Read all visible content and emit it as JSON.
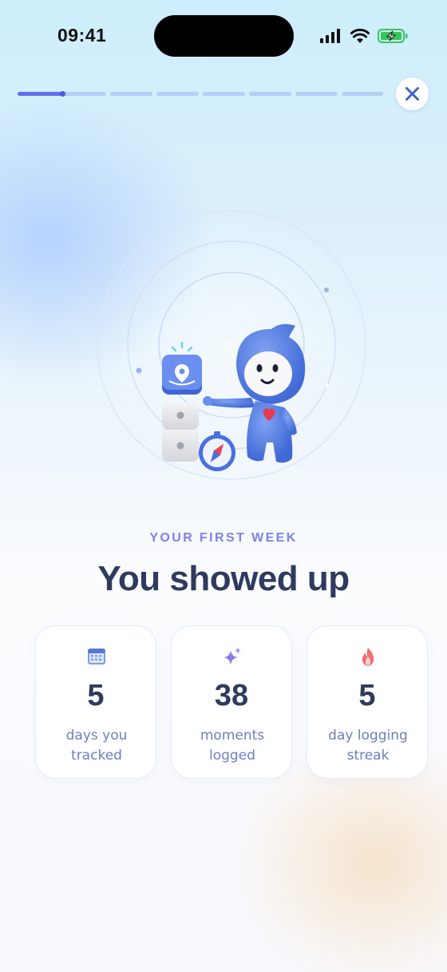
{
  "status_bar": {
    "time": "09:41"
  },
  "progress": {
    "total_steps": 8,
    "current_step": 1
  },
  "hero": {
    "kicker": "YOUR FIRST WEEK",
    "headline": "You showed up"
  },
  "stats": [
    {
      "icon": "calendar-icon",
      "value": "5",
      "label": "days you tracked",
      "icon_color": "#6b8de6"
    },
    {
      "icon": "sparkles-icon",
      "value": "38",
      "label": "moments logged",
      "icon_color": "#8a7ae8"
    },
    {
      "icon": "flame-icon",
      "value": "5",
      "label": "day logging streak",
      "icon_color": "#f07070"
    }
  ],
  "colors": {
    "accent": "#6070ea",
    "headline": "#2e3a5e",
    "kicker": "#7c82e6",
    "label": "#6b7fc0"
  }
}
